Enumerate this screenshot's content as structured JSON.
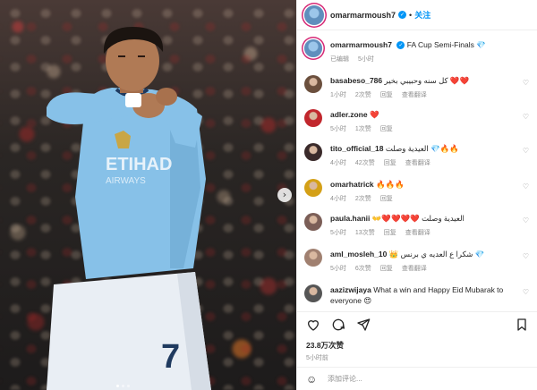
{
  "post": {
    "author": "omarmarmoush7",
    "follow_label": "关注",
    "separator": "•",
    "caption": "FA Cup Semi-Finals 💎",
    "caption_meta": "已编辑",
    "caption_time": "5小时",
    "nav_next_glyph": "›",
    "jersey_number": "7"
  },
  "comments": [
    {
      "user": "basabeso_786",
      "text": "كل سنه وحبيبي بخير ❤️❤️",
      "time": "1小时",
      "likes": "2次赞",
      "reply": "回复",
      "translate": "查看翻译",
      "avatar_color": "#6b4f3d"
    },
    {
      "user": "adler.zone",
      "text": "❤️",
      "time": "5小时",
      "likes": "1次赞",
      "reply": "回复",
      "translate": "",
      "avatar_color": "#c1272d"
    },
    {
      "user": "tito_official_18",
      "text": "العيدية وصلت 💎🔥🔥",
      "time": "4小时",
      "likes": "42次赞",
      "reply": "回复",
      "translate": "查看翻译",
      "avatar_color": "#3a2a2a"
    },
    {
      "user": "omarhatrick",
      "text": "🔥🔥🔥",
      "time": "4小时",
      "likes": "2次赞",
      "reply": "回复",
      "translate": "",
      "avatar_color": "#d4a017"
    },
    {
      "user": "paula.hanii",
      "text": "👐❤️❤️❤️❤️ العيدية وصلت",
      "time": "5小时",
      "likes": "13次赞",
      "reply": "回复",
      "translate": "查看翻译",
      "avatar_color": "#7b5e57"
    },
    {
      "user": "aml_mosleh_10",
      "text": "👑 شكرا ع العديه ي برنس 💎",
      "time": "5小时",
      "likes": "6次赞",
      "reply": "回复",
      "translate": "查看翻译",
      "avatar_color": "#a08070"
    },
    {
      "user": "aazizwijaya",
      "text": "What a win and Happy Eid Mubarak to everyone 😍",
      "time": "",
      "likes": "",
      "reply": "",
      "translate": "",
      "avatar_color": "#555555"
    }
  ],
  "actions": {
    "likes_count": "23.8万次赞",
    "time": "5小时前"
  },
  "composer": {
    "placeholder": "添加评论..."
  },
  "colors": {
    "accent": "#0095f6",
    "jersey": "#87c1e8",
    "shorts": "#e9eef4"
  }
}
